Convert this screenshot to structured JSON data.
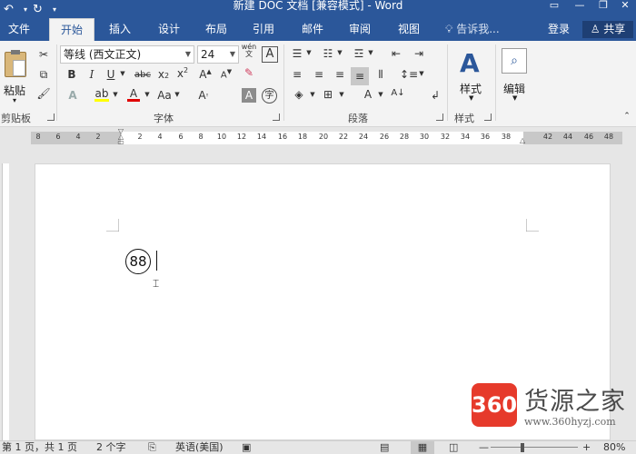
{
  "titlebar": {
    "title": "新建 DOC 文档 [兼容模式] - Word"
  },
  "tabs": [
    "文件",
    "开始",
    "插入",
    "设计",
    "布局",
    "引用",
    "邮件",
    "审阅",
    "视图"
  ],
  "tellme": "告诉我...",
  "account": {
    "login": "登录",
    "share": "共享"
  },
  "clipboard": {
    "paste": "粘贴",
    "group": "剪贴板"
  },
  "font": {
    "name": "等线 (西文正文)",
    "size": "24",
    "group": "字体",
    "phonetic": "wén"
  },
  "paragraph": {
    "group": "段落"
  },
  "styles": {
    "label": "样式",
    "group": "样式"
  },
  "editing": {
    "label": "编辑"
  },
  "ruler": {
    "numbers": [
      "8",
      "6",
      "4",
      "2",
      "2",
      "4",
      "6",
      "8",
      "10",
      "12",
      "14",
      "16",
      "18",
      "20",
      "22",
      "24",
      "26",
      "28",
      "30",
      "32",
      "34",
      "36",
      "38",
      "42",
      "44",
      "46",
      "48"
    ]
  },
  "document": {
    "enclosed_number": "88"
  },
  "status": {
    "page": "第 1 页，共 1 页",
    "words": "2 个字",
    "language": "英语(美国)",
    "zoom": "80%"
  },
  "watermark": {
    "badge": "360",
    "name": "货源之家",
    "url": "www.360hyzj.com"
  },
  "colors": {
    "accent": "#2b579a",
    "highlight": "#ffff00",
    "fontcolor": "#e00000",
    "badge": "#e63a2b"
  }
}
